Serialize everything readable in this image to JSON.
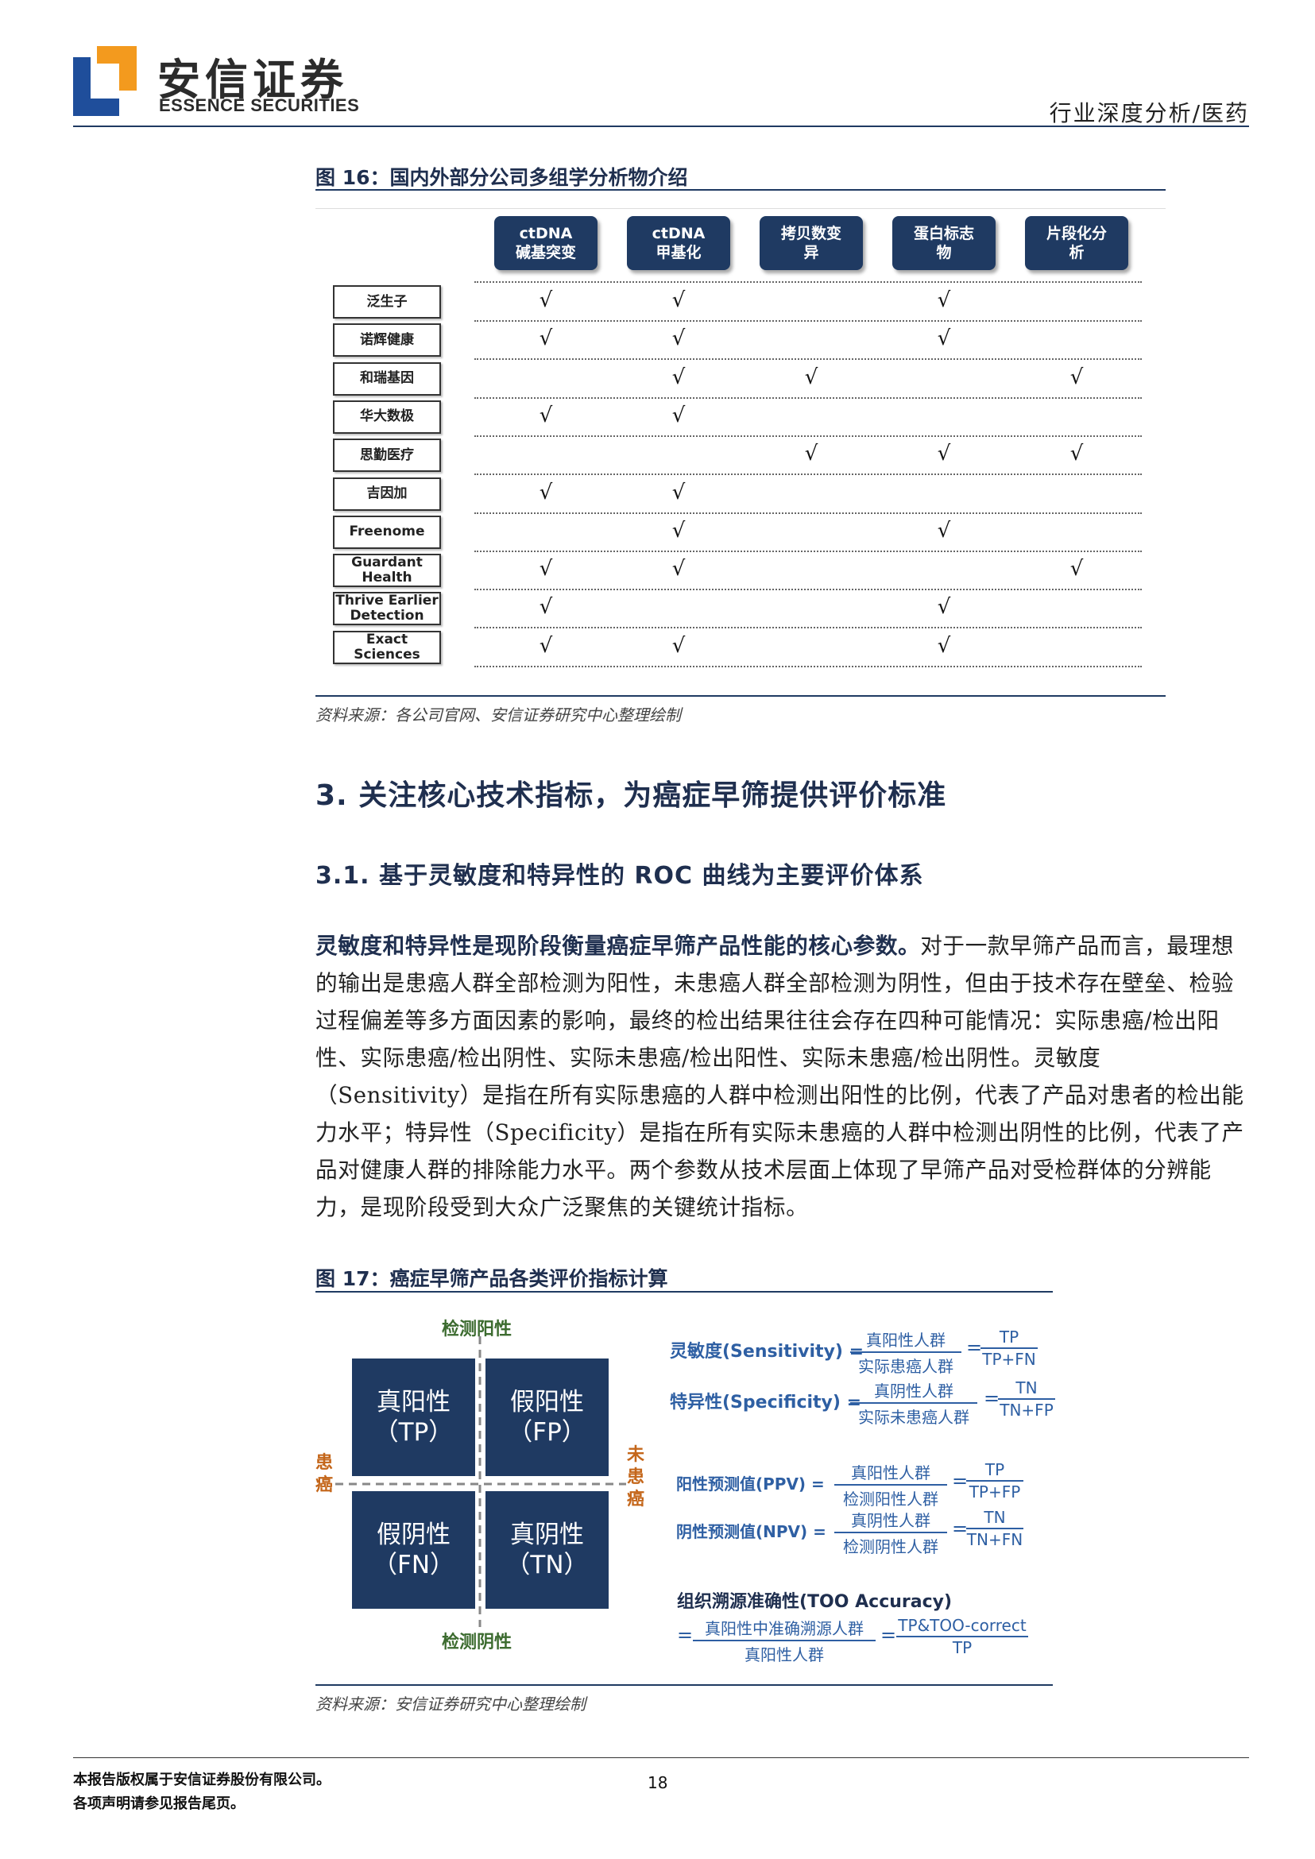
{
  "header": {
    "logo_cn": "安信证券",
    "logo_en": "ESSENCE SECURITIES",
    "section": "行业深度分析/医药"
  },
  "figure16": {
    "caption": "图 16：国内外部分公司多组学分析物介绍",
    "columns": [
      {
        "line1": "ctDNA",
        "line2": "碱基突变"
      },
      {
        "line1": "ctDNA",
        "line2": "甲基化"
      },
      {
        "line1": "拷贝数变",
        "line2": "异"
      },
      {
        "line1": "蛋白标志",
        "line2": "物"
      },
      {
        "line1": "片段化分",
        "line2": "析"
      }
    ],
    "rows": [
      {
        "line1": "泛生子",
        "line2": ""
      },
      {
        "line1": "诺辉健康",
        "line2": ""
      },
      {
        "line1": "和瑞基因",
        "line2": ""
      },
      {
        "line1": "华大数极",
        "line2": ""
      },
      {
        "line1": "思勤医疗",
        "line2": ""
      },
      {
        "line1": "吉因加",
        "line2": ""
      },
      {
        "line1": "Freenome",
        "line2": ""
      },
      {
        "line1": "Guardant",
        "line2": "Health"
      },
      {
        "line1": "Thrive Earlier",
        "line2": "Detection"
      },
      {
        "line1": "Exact",
        "line2": "Sciences"
      }
    ],
    "check_symbol": "√",
    "matrix": [
      [
        1,
        1,
        0,
        1,
        0
      ],
      [
        1,
        1,
        0,
        1,
        0
      ],
      [
        0,
        1,
        1,
        0,
        1
      ],
      [
        1,
        1,
        0,
        0,
        0
      ],
      [
        0,
        0,
        1,
        1,
        1
      ],
      [
        1,
        1,
        0,
        0,
        0
      ],
      [
        0,
        1,
        0,
        1,
        0
      ],
      [
        1,
        1,
        0,
        0,
        1
      ],
      [
        1,
        0,
        0,
        1,
        0
      ],
      [
        1,
        1,
        0,
        1,
        0
      ]
    ],
    "source": "资料来源：各公司官网、安信证券研究中心整理绘制"
  },
  "section3": {
    "title": "3. 关注核心技术指标，为癌症早筛提供评价标准",
    "sub_title": "3.1. 基于灵敏度和特异性的 ROC 曲线为主要评价体系",
    "paragraph_bold": "灵敏度和特异性是现阶段衡量癌症早筛产品性能的核心参数。",
    "paragraph_rest": "对于一款早筛产品而言，最理想的输出是患癌人群全部检测为阳性，未患癌人群全部检测为阴性，但由于技术存在壁垒、检验过程偏差等多方面因素的影响，最终的检出结果往往会存在四种可能情况：实际患癌/检出阳性、实际患癌/检出阴性、实际未患癌/检出阳性、实际未患癌/检出阴性。灵敏度（Sensitivity）是指在所有实际患癌的人群中检测出阳性的比例，代表了产品对患者的检出能力水平；特异性（Specificity）是指在所有实际未患癌的人群中检测出阴性的比例，代表了产品对健康人群的排除能力水平。两个参数从技术层面上体现了早筛产品对受检群体的分辨能力，是现阶段受到大众广泛聚焦的关键统计指标。"
  },
  "figure17": {
    "caption": "图 17：癌症早筛产品各类评价指标计算",
    "axis_top": "检测阳性",
    "axis_bottom": "检测阴性",
    "axis_left": [
      "患",
      "癌"
    ],
    "axis_right": [
      "未",
      "患",
      "癌"
    ],
    "quadrants": [
      {
        "cn": "真阳性",
        "abbr": "（TP）"
      },
      {
        "cn": "假阳性",
        "abbr": "（FP）"
      },
      {
        "cn": "假阴性",
        "abbr": "（FN）"
      },
      {
        "cn": "真阴性",
        "abbr": "（TN）"
      }
    ],
    "formulas": {
      "sens_label": "灵敏度(Sensitivity) =",
      "sens_num": "真阳性人群",
      "sens_den": "实际患癌人群",
      "sens_abbr_num": "TP",
      "sens_abbr_den": "TP+FN",
      "spec_label": "特异性(Specificity) =",
      "spec_num": "真阴性人群",
      "spec_den": "实际未患癌人群",
      "spec_abbr_num": "TN",
      "spec_abbr_den": "TN+FP",
      "ppv_label": "阳性预测值(PPV) =",
      "ppv_num": "真阳性人群",
      "ppv_den": "检测阳性人群",
      "ppv_abbr_num": "TP",
      "ppv_abbr_den": "TP+FP",
      "npv_label": "阴性预测值(NPV) =",
      "npv_num": "真阴性人群",
      "npv_den": "检测阴性人群",
      "npv_abbr_num": "TN",
      "npv_abbr_den": "TN+FN",
      "too_label": "组织溯源准确性(TOO Accuracy)",
      "too_num": "真阳性中准确溯源人群",
      "too_den": "真阳性人群",
      "too_abbr_num": "TP&TOO-correct",
      "too_abbr_den": "TP",
      "eq": "="
    },
    "source": "资料来源：安信证券研究中心整理绘制"
  },
  "footer": {
    "line1": "本报告版权属于安信证券股份有限公司。",
    "line2": "各项声明请参见报告尾页。",
    "page_number": "18"
  }
}
